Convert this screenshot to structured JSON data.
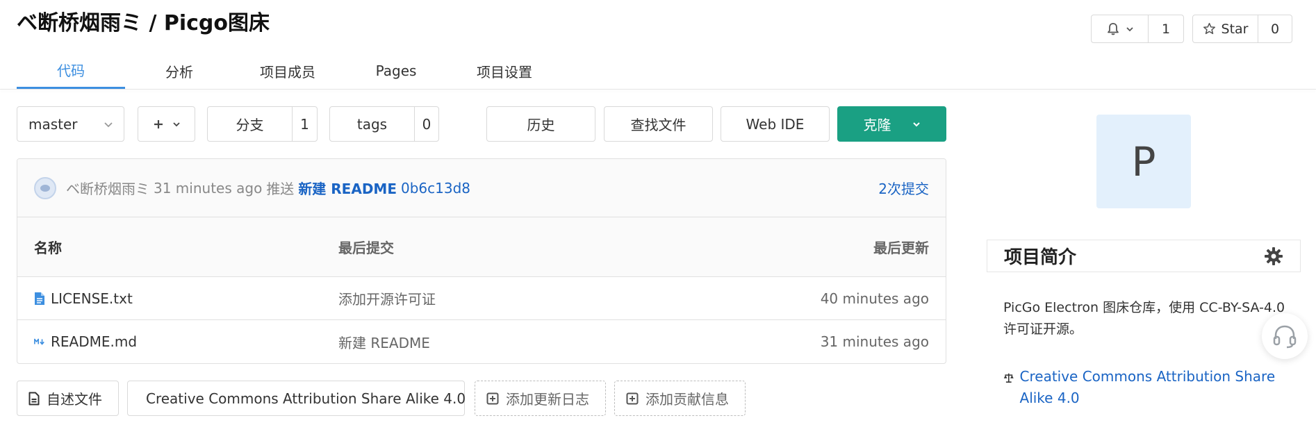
{
  "repo": {
    "title": "ベ断桥烟雨ミ / Picgo图床"
  },
  "watch": {
    "count": "1"
  },
  "star": {
    "label": "Star",
    "count": "0"
  },
  "tabs": [
    {
      "label": "代码",
      "active": true
    },
    {
      "label": "分析"
    },
    {
      "label": "项目成员"
    },
    {
      "label": "Pages"
    },
    {
      "label": "项目设置"
    }
  ],
  "toolbar": {
    "branch": "master",
    "branches_label": "分支",
    "branches_count": "1",
    "tags_label": "tags",
    "tags_count": "0",
    "history": "历史",
    "find_file": "查找文件",
    "web_ide": "Web IDE",
    "clone": "克隆"
  },
  "commit": {
    "author": "ベ断桥烟雨ミ",
    "time": "31 minutes ago",
    "action": "推送",
    "message": "新建 README",
    "sha": "0b6c13d8",
    "count": "2次提交"
  },
  "table": {
    "headers": {
      "name": "名称",
      "last_commit": "最后提交",
      "last_update": "最后更新"
    },
    "rows": [
      {
        "name": "LICENSE.txt",
        "commit": "添加开源许可证",
        "updated": "40 minutes ago"
      },
      {
        "name": "README.md",
        "commit": "新建 README",
        "updated": "31 minutes ago"
      }
    ]
  },
  "bottom": {
    "readme": "自述文件",
    "license": "Creative Commons Attribution Share Alike 4.0",
    "changelog": "添加更新日志",
    "contrib": "添加贡献信息"
  },
  "sidebar": {
    "avatar_letter": "P",
    "intro_title": "项目简介",
    "description": "PicGo Electron 图床仓库，使用 CC-BY-SA-4.0 许可证开源。",
    "license": "Creative Commons Attribution Share Alike 4.0"
  },
  "colors": {
    "accent": "#3d8fe0",
    "clone": "#1aa083",
    "link": "#1a64c4"
  }
}
